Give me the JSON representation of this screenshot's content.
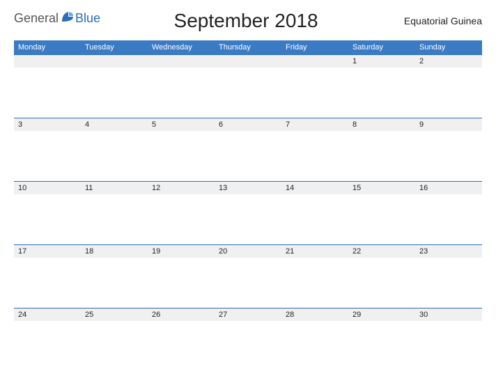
{
  "header": {
    "logo_general": "General",
    "logo_blue": "Blue",
    "title": "September 2018",
    "region": "Equatorial Guinea"
  },
  "weekdays": [
    "Monday",
    "Tuesday",
    "Wednesday",
    "Thursday",
    "Friday",
    "Saturday",
    "Sunday"
  ],
  "weeks": [
    [
      "",
      "",
      "",
      "",
      "",
      "1",
      "2"
    ],
    [
      "3",
      "4",
      "5",
      "6",
      "7",
      "8",
      "9"
    ],
    [
      "10",
      "11",
      "12",
      "13",
      "14",
      "15",
      "16"
    ],
    [
      "17",
      "18",
      "19",
      "20",
      "21",
      "22",
      "23"
    ],
    [
      "24",
      "25",
      "26",
      "27",
      "28",
      "29",
      "30"
    ]
  ]
}
